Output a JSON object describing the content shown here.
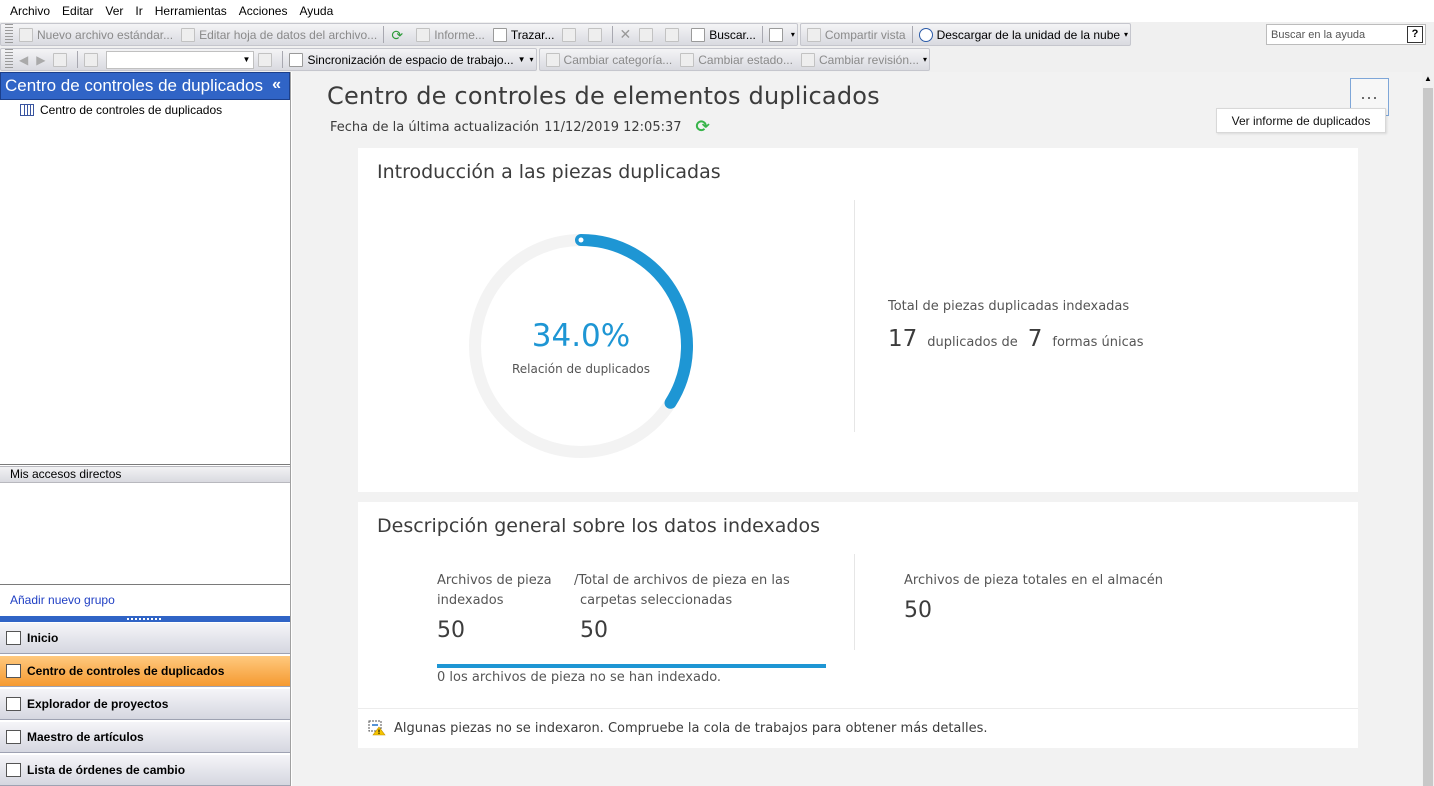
{
  "menu": [
    "Archivo",
    "Editar",
    "Ver",
    "Ir",
    "Herramientas",
    "Acciones",
    "Ayuda"
  ],
  "toolbar1": {
    "new_file": "Nuevo archivo estándar...",
    "edit_datasheet": "Editar hoja de datos del archivo...",
    "report": "Informe...",
    "plot": "Trazar...",
    "find": "Buscar...",
    "share_view": "Compartir vista",
    "cloud_download": "Descargar de la unidad de la nube"
  },
  "help_search": {
    "placeholder": "Buscar en la ayuda",
    "help_button": "?"
  },
  "toolbar2": {
    "workspace_sync": "Sincronización de espacio de trabajo...",
    "change_category": "Cambiar categoría...",
    "change_state": "Cambiar estado...",
    "change_revision": "Cambiar revisión..."
  },
  "left_panel": {
    "header": "Centro de controles de duplicados",
    "collapse_glyph": "«",
    "tree_item": "Centro de controles de duplicados",
    "shortcuts_header": "Mis accesos directos",
    "add_group": "Añadir nuevo grupo",
    "nav": [
      {
        "label": "Inicio",
        "active": false
      },
      {
        "label": "Centro de controles de duplicados",
        "active": true
      },
      {
        "label": "Explorador de proyectos",
        "active": false
      },
      {
        "label": "Maestro de artículos",
        "active": false
      },
      {
        "label": "Lista de órdenes de cambio",
        "active": false
      }
    ]
  },
  "main": {
    "title": "Centro de controles de elementos duplicados",
    "last_update_label": "Fecha de la última actualización",
    "last_update_value": "11/12/2019 12:05:37",
    "more_glyph": "...",
    "tooltip": "Ver informe de duplicados",
    "intro": {
      "title": "Introducción a las piezas duplicadas",
      "ratio_text": "34.0%",
      "ratio_value": 0.34,
      "ratio_label": "Relación de duplicados",
      "total_label": "Total de piezas duplicadas indexadas",
      "duplicates": "17",
      "duplicates_label": "duplicados de",
      "unique": "7",
      "unique_label": "formas únicas"
    },
    "overview": {
      "title": "Descripción general sobre los datos indexados",
      "indexed_label_1": "Archivos de pieza",
      "indexed_label_2": "indexados",
      "indexed_value": "50",
      "total_label_1": "/Total de archivos de pieza en las",
      "total_label_2": "carpetas seleccionadas",
      "total_value": "50",
      "indexed_fraction": 1.0,
      "vault_label": "Archivos de pieza totales en el almacén",
      "vault_value": "50",
      "not_indexed": "0  los archivos de pieza no se han indexado.",
      "warning": "Algunas piezas no se indexaron. Compruebe la cola de trabajos para obtener más detalles."
    }
  },
  "colors": {
    "accent": "#1e96d4",
    "header_blue": "#3064c6",
    "active_nav": "#f59a31",
    "refresh_green": "#38b44a"
  }
}
